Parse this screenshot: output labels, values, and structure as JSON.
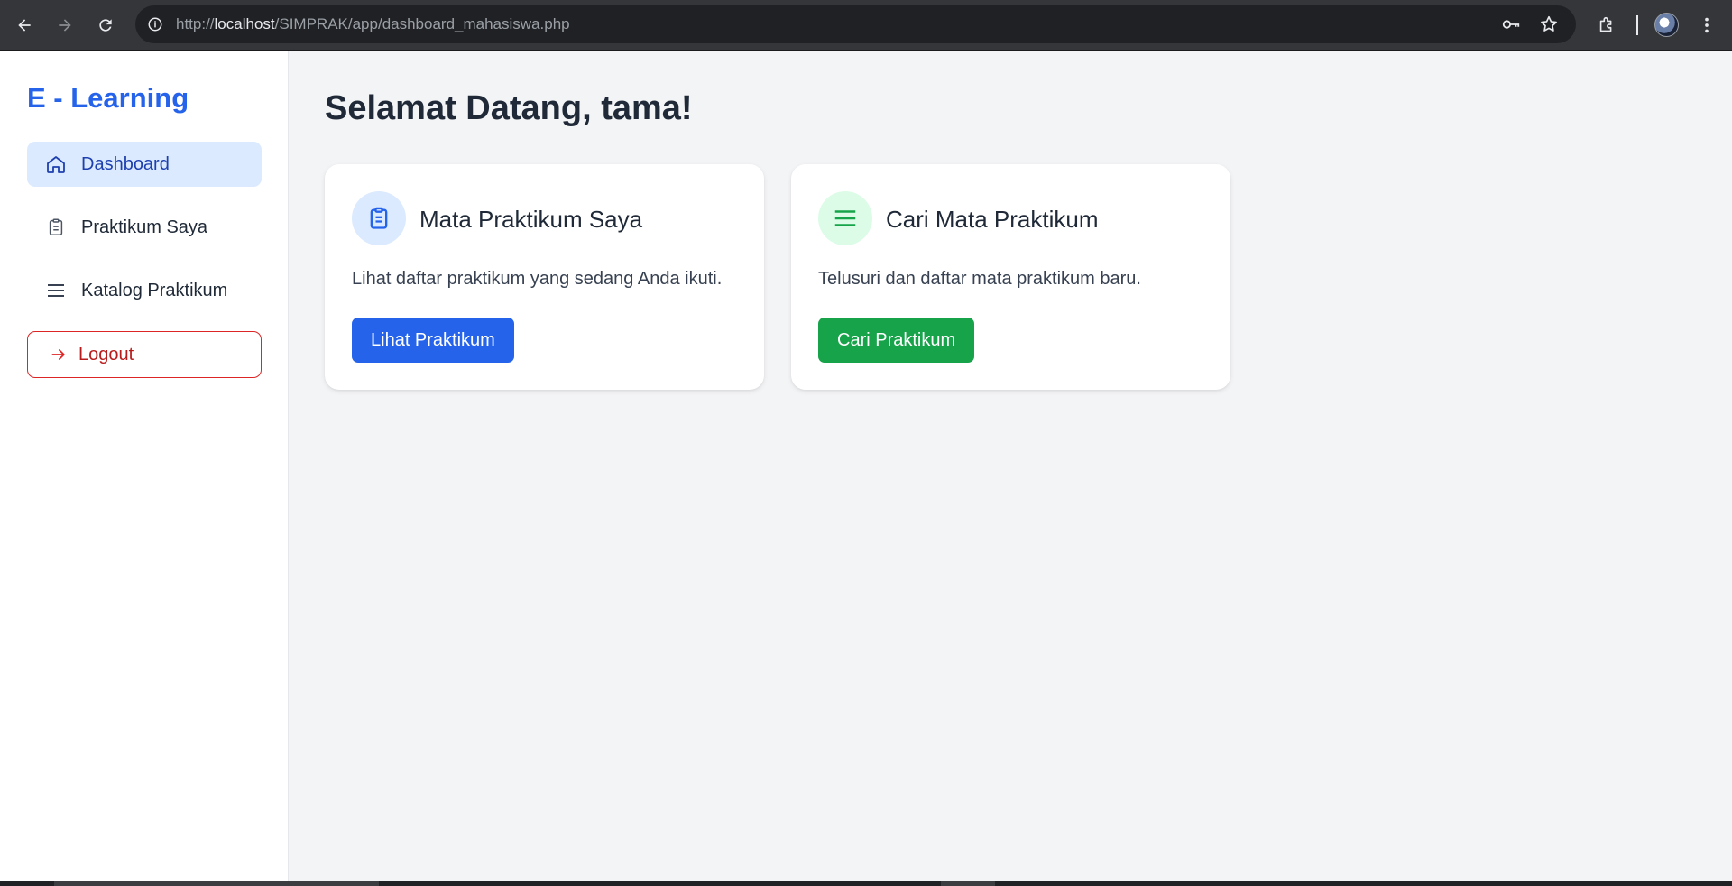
{
  "browser": {
    "url_prefix": "http://",
    "url_host": "localhost",
    "url_path": "/SIMPRAK/app/dashboard_mahasiswa.php",
    "icons": [
      "back-icon",
      "forward-icon",
      "reload-icon",
      "info-icon",
      "key-icon",
      "star-icon",
      "extensions-icon",
      "profile-avatar",
      "more-icon"
    ]
  },
  "sidebar": {
    "brand": "E - Learning",
    "items": [
      {
        "label": "Dashboard",
        "icon": "home-icon",
        "active": true
      },
      {
        "label": "Praktikum Saya",
        "icon": "clipboard-icon",
        "active": false
      },
      {
        "label": "Katalog Praktikum",
        "icon": "list-icon",
        "active": false
      }
    ],
    "logout": {
      "label": "Logout",
      "icon": "arrow-right-icon"
    }
  },
  "main": {
    "welcome": "Selamat Datang, tama!",
    "cards": [
      {
        "title": "Mata Praktikum Saya",
        "description": "Lihat daftar praktikum yang sedang Anda ikuti.",
        "button": "Lihat Praktikum",
        "icon": "clipboard-icon",
        "color": "#2563eb",
        "icon_bg": "#dbeafe"
      },
      {
        "title": "Cari Mata Praktikum",
        "description": "Telusuri dan daftar mata praktikum baru.",
        "button": "Cari Praktikum",
        "icon": "list-icon",
        "color": "#16a34a",
        "icon_bg": "#dcfce7"
      }
    ]
  }
}
